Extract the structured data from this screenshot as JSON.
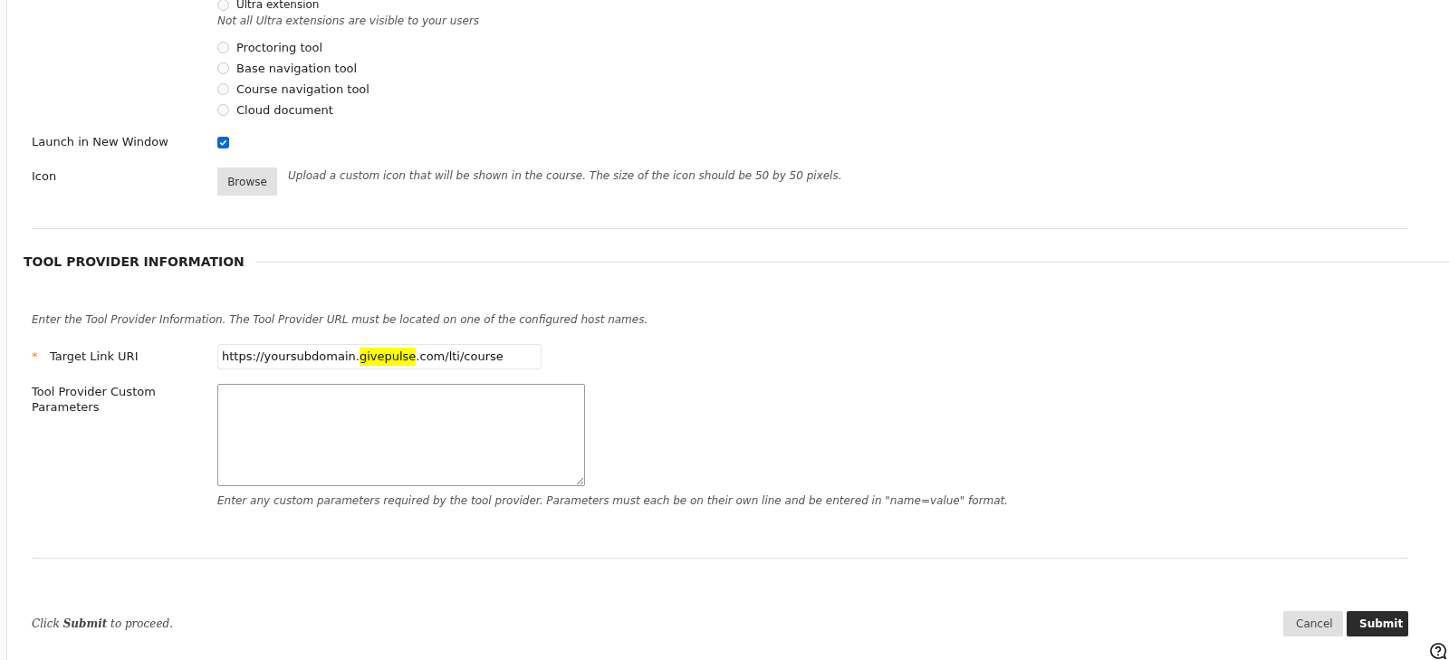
{
  "placement": {
    "cut_option": {
      "label": "Ultra extension",
      "selected": false
    },
    "note": "Not all Ultra extensions are visible to your users",
    "options": [
      {
        "label": "Proctoring tool",
        "selected": false
      },
      {
        "label": "Base navigation tool",
        "selected": false
      },
      {
        "label": "Course navigation tool",
        "selected": false
      },
      {
        "label": "Cloud document",
        "selected": false
      }
    ]
  },
  "launch": {
    "label": "Launch in New Window",
    "checked": true
  },
  "icon": {
    "label": "Icon",
    "button": "Browse",
    "hint": "Upload a custom icon that will be shown in the course. The size of the icon should be 50 by 50 pixels."
  },
  "section": {
    "title": "TOOL PROVIDER INFORMATION",
    "intro": "Enter the Tool Provider Information. The Tool Provider URL must be located on one of the configured host names.",
    "target": {
      "required_mark": "*",
      "label": "Target Link URI",
      "value_parts": [
        {
          "text": "https://yoursubdomain.",
          "highlighted": false
        },
        {
          "text": "givepulse",
          "highlighted": true
        },
        {
          "text": ".com/lti/course",
          "highlighted": false
        }
      ]
    },
    "custom": {
      "label": "Tool Provider Custom Parameters",
      "hint": "Enter any custom parameters required by the tool provider. Parameters must each be on their own line and be entered in \"name=value\" format."
    }
  },
  "footer": {
    "instruction": "Click **Submit** to proceed.",
    "buttons": [
      {
        "label": "Cancel",
        "kind": "secondary"
      },
      {
        "label": "Submit",
        "kind": "primary"
      }
    ]
  }
}
